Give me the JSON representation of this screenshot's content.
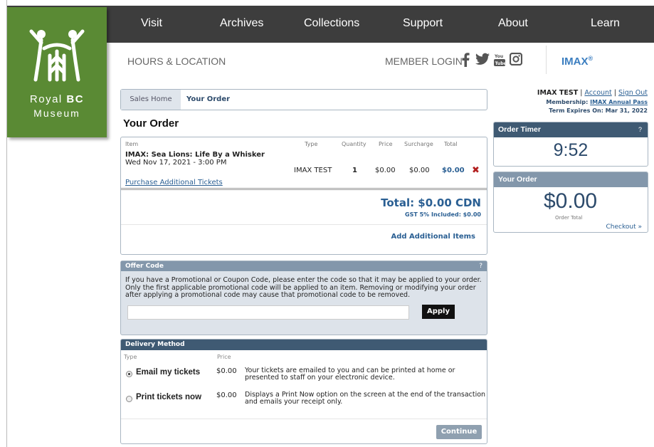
{
  "nav": {
    "items": [
      "Visit",
      "Archives",
      "Collections",
      "Support",
      "About",
      "Learn"
    ]
  },
  "logo": {
    "line1_a": "Royal ",
    "line1_b": "BC",
    "line2": "Museum"
  },
  "header": {
    "hours": "HOURS & LOCATION",
    "member_login": "MEMBER LOGIN",
    "social_icons": [
      "facebook-icon",
      "twitter-icon",
      "youtube-icon",
      "instagram-icon"
    ],
    "imax": "IMAX",
    "imax_mark": "®"
  },
  "breadcrumb": {
    "home": "Sales Home",
    "current": "Your Order"
  },
  "page_title": "Your Order",
  "order": {
    "columns": [
      "Item",
      "Type",
      "Quantity",
      "Price",
      "Surcharge",
      "Total"
    ],
    "item_name": "IMAX: Sea Lions: Life By a Whisker",
    "item_date": "Wed Nov 17, 2021 - 3:00 PM",
    "type": "IMAX TEST",
    "quantity": "1",
    "price": "$0.00",
    "surcharge": "$0.00",
    "total": "$0.00",
    "delete_symbol": "✖",
    "purchase_link": "Purchase Additional Tickets",
    "grand_total": "Total: $0.00 CDN",
    "gst": "GST 5% Included: $0.00",
    "add_items": "Add Additional Items"
  },
  "offer": {
    "title": "Offer Code",
    "help": "?",
    "text": "If you have a Promotional or Coupon Code, please enter the code so that it may be applied to your order. Only the first applicable promotional code will be applied to an item. Removing or modifying your order after applying a promotional code may cause that promotional code to be removed.",
    "input_value": "",
    "apply": "Apply"
  },
  "delivery": {
    "title": "Delivery Method",
    "col_type": "Type",
    "col_price": "Price",
    "options": [
      {
        "label": "Email my tickets",
        "price": "$0.00",
        "desc": "Your tickets are emailed to you and can be printed at home or presented to staff on your electronic device.",
        "selected": true
      },
      {
        "label": "Print tickets now",
        "price": "$0.00",
        "desc": "Displays a Print Now option on the screen at the end of the transaction and emails your receipt only.",
        "selected": false
      }
    ],
    "continue": "Continue"
  },
  "account": {
    "user": "IMAX TEST",
    "sep": " | ",
    "account_link": "Account",
    "signout_link": "Sign Out",
    "membership_label": "Membership: ",
    "membership_value": "IMAX Annual Pass",
    "term": "Term Expires On: Mar 31, 2022"
  },
  "timer": {
    "title": "Order Timer",
    "help": "?",
    "value": "9:52"
  },
  "summary": {
    "title": "Your Order",
    "amount": "$0.00",
    "label": "Order Total",
    "checkout": "Checkout »"
  },
  "colors": {
    "nav_bg": "#3d3d3d",
    "logo_green": "#5a8a34",
    "panel_dark": "#3f5a73",
    "panel_light": "#8397ab",
    "link": "#2a5f93",
    "delete": "#b21e1e"
  }
}
